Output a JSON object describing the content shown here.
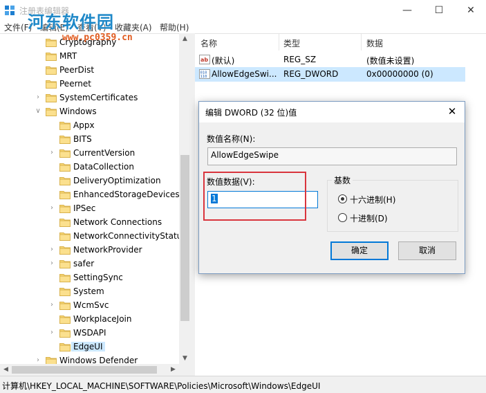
{
  "window": {
    "title": "注册表编辑器",
    "minimize_icon": "minimize-icon",
    "maximize_icon": "maximize-icon",
    "close_icon": "close-icon"
  },
  "watermark": {
    "text": "河东软件园",
    "url": "www.pc0359.cn"
  },
  "menu": [
    {
      "label": "文件(F)"
    },
    {
      "label": "编辑(E)"
    },
    {
      "label": "查看(V)"
    },
    {
      "label": "收藏夹(A)"
    },
    {
      "label": "帮助(H)"
    }
  ],
  "tree": [
    {
      "label": "Cryptography",
      "level": 1,
      "expandable": false
    },
    {
      "label": "MRT",
      "level": 1,
      "expandable": false
    },
    {
      "label": "PeerDist",
      "level": 1,
      "expandable": false
    },
    {
      "label": "Peernet",
      "level": 1,
      "expandable": false
    },
    {
      "label": "SystemCertificates",
      "level": 1,
      "expandable": true
    },
    {
      "label": "Windows",
      "level": 1,
      "expandable": true,
      "expanded": true
    },
    {
      "label": "Appx",
      "level": 2,
      "expandable": false
    },
    {
      "label": "BITS",
      "level": 2,
      "expandable": false
    },
    {
      "label": "CurrentVersion",
      "level": 2,
      "expandable": true
    },
    {
      "label": "DataCollection",
      "level": 2,
      "expandable": false
    },
    {
      "label": "DeliveryOptimization",
      "level": 2,
      "expandable": false
    },
    {
      "label": "EnhancedStorageDevices",
      "level": 2,
      "expandable": false
    },
    {
      "label": "IPSec",
      "level": 2,
      "expandable": true
    },
    {
      "label": "Network Connections",
      "level": 2,
      "expandable": false
    },
    {
      "label": "NetworkConnectivityStatus",
      "level": 2,
      "expandable": false
    },
    {
      "label": "NetworkProvider",
      "level": 2,
      "expandable": true
    },
    {
      "label": "safer",
      "level": 2,
      "expandable": true
    },
    {
      "label": "SettingSync",
      "level": 2,
      "expandable": false
    },
    {
      "label": "System",
      "level": 2,
      "expandable": false
    },
    {
      "label": "WcmSvc",
      "level": 2,
      "expandable": true
    },
    {
      "label": "WorkplaceJoin",
      "level": 2,
      "expandable": false
    },
    {
      "label": "WSDAPI",
      "level": 2,
      "expandable": true
    },
    {
      "label": "EdgeUI",
      "level": 2,
      "expandable": false,
      "selected": true
    },
    {
      "label": "Windows Defender",
      "level": 1,
      "expandable": true
    }
  ],
  "list": {
    "columns": [
      "名称",
      "类型",
      "数据"
    ],
    "rows": [
      {
        "name": "(默认)",
        "type": "REG_SZ",
        "data": "(数值未设置)",
        "icon": "string-value-icon",
        "selected": false
      },
      {
        "name": "AllowEdgeSwi...",
        "type": "REG_DWORD",
        "data": "0x00000000 (0)",
        "icon": "binary-value-icon",
        "selected": true
      }
    ]
  },
  "status": {
    "path": "计算机\\HKEY_LOCAL_MACHINE\\SOFTWARE\\Policies\\Microsoft\\Windows\\EdgeUI"
  },
  "dialog": {
    "title": "编辑 DWORD (32 位)值",
    "name_label": "数值名称(N):",
    "name_value": "AllowEdgeSwipe",
    "data_label": "数值数据(V):",
    "data_value": "1",
    "base_legend": "基数",
    "radio_hex": "十六进制(H)",
    "radio_dec": "十进制(D)",
    "base_selected": "hex",
    "ok": "确定",
    "cancel": "取消"
  },
  "colors": {
    "accent": "#0078d7",
    "highlight_box": "#d9343d",
    "selection": "#cce8ff",
    "folder": "#f4d26a"
  }
}
